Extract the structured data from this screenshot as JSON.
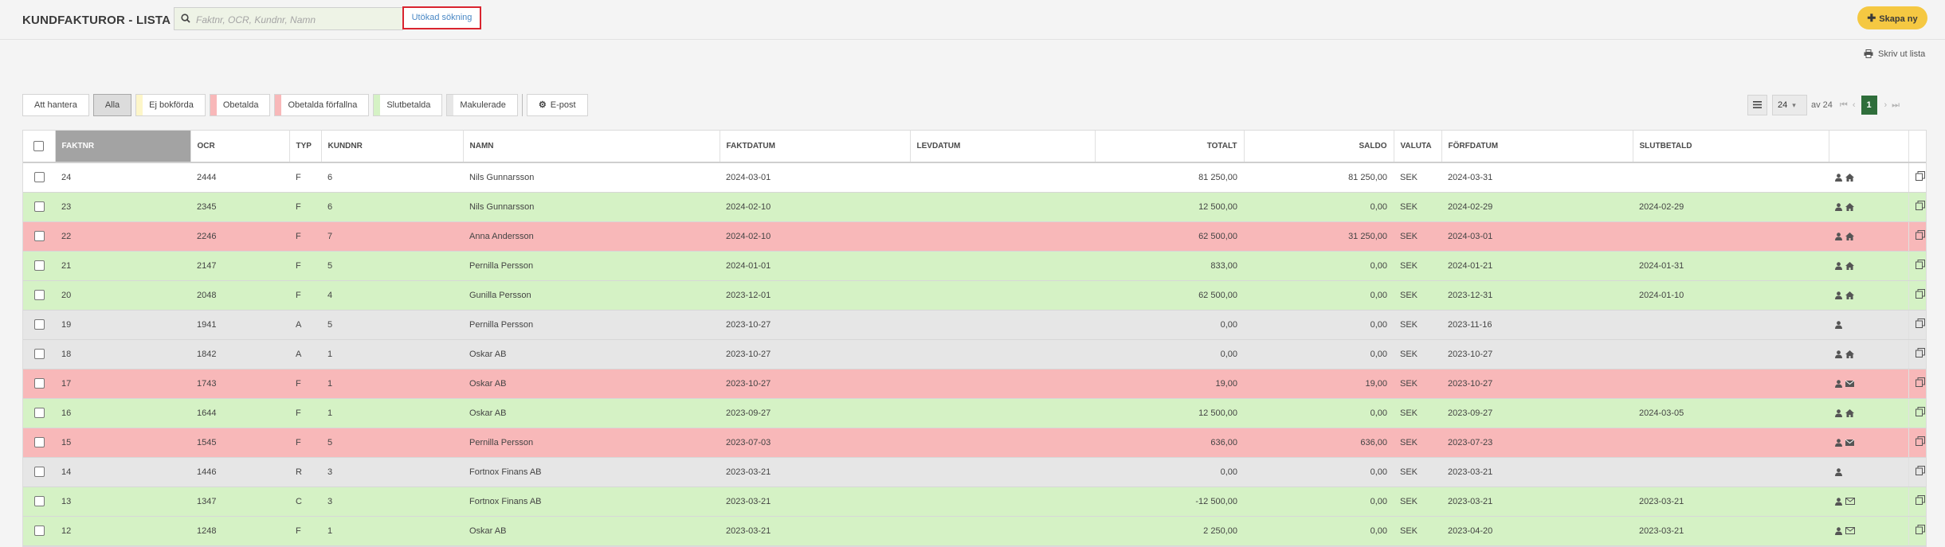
{
  "header": {
    "title": "KUNDFAKTUROR - LISTA",
    "search_placeholder": "Faktnr, OCR, Kundnr, Namn",
    "advanced_search": "Utökad sökning",
    "create_label": "Skapa ny"
  },
  "print_label": "Skriv ut lista",
  "filters": [
    {
      "label": "Att hantera",
      "active": false,
      "swatch": ""
    },
    {
      "label": "Alla",
      "active": true,
      "swatch": ""
    },
    {
      "label": "Ej bokförda",
      "active": false,
      "swatch": "#fdf6c9"
    },
    {
      "label": "Obetalda",
      "active": false,
      "swatch": "#f8b8b9"
    },
    {
      "label": "Obetalda förfallna",
      "active": false,
      "swatch": "#f8b8b9"
    },
    {
      "label": "Slutbetalda",
      "active": false,
      "swatch": "#d5f2c5"
    },
    {
      "label": "Makulerade",
      "active": false,
      "swatch": "#e6e6e6"
    }
  ],
  "email_label": "E-post",
  "pager": {
    "page_size": "24",
    "of_label": "av 24",
    "current_page": "1"
  },
  "columns": [
    "FAKTNR",
    "OCR",
    "TYP",
    "KUNDNR",
    "NAMN",
    "FAKTDATUM",
    "LEVDATUM",
    "TOTALT",
    "SALDO",
    "VALUTA",
    "FÖRFDATUM",
    "SLUTBETALD"
  ],
  "status_colors": {
    "white": "#ffffff",
    "green": "#d5f2c5",
    "red": "#f8b8b9",
    "grey": "#e6e6e6"
  },
  "rows": [
    {
      "status": "white",
      "faktnr": "24",
      "ocr": "2444",
      "typ": "F",
      "kundnr": "6",
      "namn": "Nils Gunnarsson",
      "faktdatum": "2024-03-01",
      "levdatum": "",
      "totalt": "81 250,00",
      "saldo": "81 250,00",
      "valuta": "SEK",
      "forfdatum": "2024-03-31",
      "slutbetald": "",
      "icons": [
        "user-icon",
        "home-icon"
      ]
    },
    {
      "status": "green",
      "faktnr": "23",
      "ocr": "2345",
      "typ": "F",
      "kundnr": "6",
      "namn": "Nils Gunnarsson",
      "faktdatum": "2024-02-10",
      "levdatum": "",
      "totalt": "12 500,00",
      "saldo": "0,00",
      "valuta": "SEK",
      "forfdatum": "2024-02-29",
      "slutbetald": "2024-02-29",
      "icons": [
        "user-icon",
        "home-icon"
      ]
    },
    {
      "status": "red",
      "faktnr": "22",
      "ocr": "2246",
      "typ": "F",
      "kundnr": "7",
      "namn": "Anna Andersson",
      "faktdatum": "2024-02-10",
      "levdatum": "",
      "totalt": "62 500,00",
      "saldo": "31 250,00",
      "valuta": "SEK",
      "forfdatum": "2024-03-01",
      "slutbetald": "",
      "icons": [
        "user-icon",
        "home-icon"
      ]
    },
    {
      "status": "green",
      "faktnr": "21",
      "ocr": "2147",
      "typ": "F",
      "kundnr": "5",
      "namn": "Pernilla Persson",
      "faktdatum": "2024-01-01",
      "levdatum": "",
      "totalt": "833,00",
      "saldo": "0,00",
      "valuta": "SEK",
      "forfdatum": "2024-01-21",
      "slutbetald": "2024-01-31",
      "icons": [
        "user-icon",
        "home-icon"
      ]
    },
    {
      "status": "green",
      "faktnr": "20",
      "ocr": "2048",
      "typ": "F",
      "kundnr": "4",
      "namn": "Gunilla Persson",
      "faktdatum": "2023-12-01",
      "levdatum": "",
      "totalt": "62 500,00",
      "saldo": "0,00",
      "valuta": "SEK",
      "forfdatum": "2023-12-31",
      "slutbetald": "2024-01-10",
      "icons": [
        "user-icon",
        "home-icon"
      ]
    },
    {
      "status": "grey",
      "faktnr": "19",
      "ocr": "1941",
      "typ": "A",
      "kundnr": "5",
      "namn": "Pernilla Persson",
      "faktdatum": "2023-10-27",
      "levdatum": "",
      "totalt": "0,00",
      "saldo": "0,00",
      "valuta": "SEK",
      "forfdatum": "2023-11-16",
      "slutbetald": "",
      "icons": [
        "user-icon"
      ]
    },
    {
      "status": "grey",
      "faktnr": "18",
      "ocr": "1842",
      "typ": "A",
      "kundnr": "1",
      "namn": "Oskar AB",
      "faktdatum": "2023-10-27",
      "levdatum": "",
      "totalt": "0,00",
      "saldo": "0,00",
      "valuta": "SEK",
      "forfdatum": "2023-10-27",
      "slutbetald": "",
      "icons": [
        "user-icon",
        "home-icon"
      ]
    },
    {
      "status": "red",
      "faktnr": "17",
      "ocr": "1743",
      "typ": "F",
      "kundnr": "1",
      "namn": "Oskar AB",
      "faktdatum": "2023-10-27",
      "levdatum": "",
      "totalt": "19,00",
      "saldo": "19,00",
      "valuta": "SEK",
      "forfdatum": "2023-10-27",
      "slutbetald": "",
      "icons": [
        "user-icon",
        "envelope-icon"
      ]
    },
    {
      "status": "green",
      "faktnr": "16",
      "ocr": "1644",
      "typ": "F",
      "kundnr": "1",
      "namn": "Oskar AB",
      "faktdatum": "2023-09-27",
      "levdatum": "",
      "totalt": "12 500,00",
      "saldo": "0,00",
      "valuta": "SEK",
      "forfdatum": "2023-09-27",
      "slutbetald": "2024-03-05",
      "icons": [
        "user-icon",
        "home-icon"
      ]
    },
    {
      "status": "red",
      "faktnr": "15",
      "ocr": "1545",
      "typ": "F",
      "kundnr": "5",
      "namn": "Pernilla Persson",
      "faktdatum": "2023-07-03",
      "levdatum": "",
      "totalt": "636,00",
      "saldo": "636,00",
      "valuta": "SEK",
      "forfdatum": "2023-07-23",
      "slutbetald": "",
      "icons": [
        "user-icon",
        "envelope-icon"
      ]
    },
    {
      "status": "grey",
      "faktnr": "14",
      "ocr": "1446",
      "typ": "R",
      "kundnr": "3",
      "namn": "Fortnox Finans AB",
      "faktdatum": "2023-03-21",
      "levdatum": "",
      "totalt": "0,00",
      "saldo": "0,00",
      "valuta": "SEK",
      "forfdatum": "2023-03-21",
      "slutbetald": "",
      "icons": [
        "user-icon"
      ]
    },
    {
      "status": "green",
      "faktnr": "13",
      "ocr": "1347",
      "typ": "C",
      "kundnr": "3",
      "namn": "Fortnox Finans AB",
      "faktdatum": "2023-03-21",
      "levdatum": "",
      "totalt": "-12 500,00",
      "saldo": "0,00",
      "valuta": "SEK",
      "forfdatum": "2023-03-21",
      "slutbetald": "2023-03-21",
      "icons": [
        "user-icon",
        "envelope-outline-icon"
      ]
    },
    {
      "status": "green",
      "faktnr": "12",
      "ocr": "1248",
      "typ": "F",
      "kundnr": "1",
      "namn": "Oskar AB",
      "faktdatum": "2023-03-21",
      "levdatum": "",
      "totalt": "2 250,00",
      "saldo": "0,00",
      "valuta": "SEK",
      "forfdatum": "2023-04-20",
      "slutbetald": "2023-03-21",
      "icons": [
        "user-icon",
        "envelope-outline-icon"
      ]
    }
  ]
}
